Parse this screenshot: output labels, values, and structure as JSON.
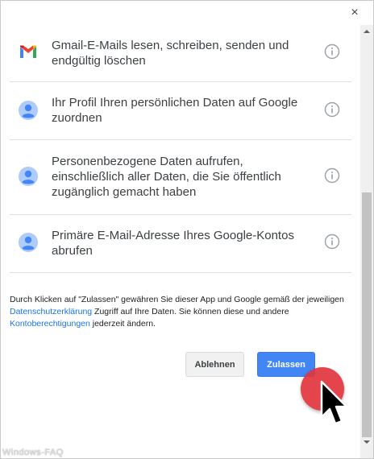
{
  "dialog": {
    "close_label": "×"
  },
  "permissions": [
    {
      "icon": "gmail-icon",
      "text": "Gmail-E-Mails lesen, schreiben, senden und endgültig löschen"
    },
    {
      "icon": "profile-icon",
      "text": "Ihr Profil Ihren persönlichen Daten auf Google zuordnen"
    },
    {
      "icon": "profile-icon",
      "text": "Personenbezogene Daten aufrufen, einschließlich aller Daten, die Sie öffentlich zugänglich gemacht haben"
    },
    {
      "icon": "profile-icon",
      "text": "Primäre E-Mail-Adresse Ihres Google-Kontos abrufen"
    }
  ],
  "disclaimer": {
    "part1": "Durch Klicken auf \"Zulassen\" gewähren Sie dieser App und Google gemäß der jeweiligen ",
    "link1": "Datenschutzerklärung",
    "part2": " Zugriff auf Ihre Daten. Sie können diese und andere ",
    "link2": "Kontoberechtigungen",
    "part3": " jederzeit ändern."
  },
  "buttons": {
    "deny_label": "Ablehnen",
    "allow_label": "Zulassen"
  },
  "watermark": "Windows-FAQ",
  "colors": {
    "link": "#1a73e8",
    "allow_button": "#4285f4",
    "cursor_highlight": "#e2363d"
  }
}
